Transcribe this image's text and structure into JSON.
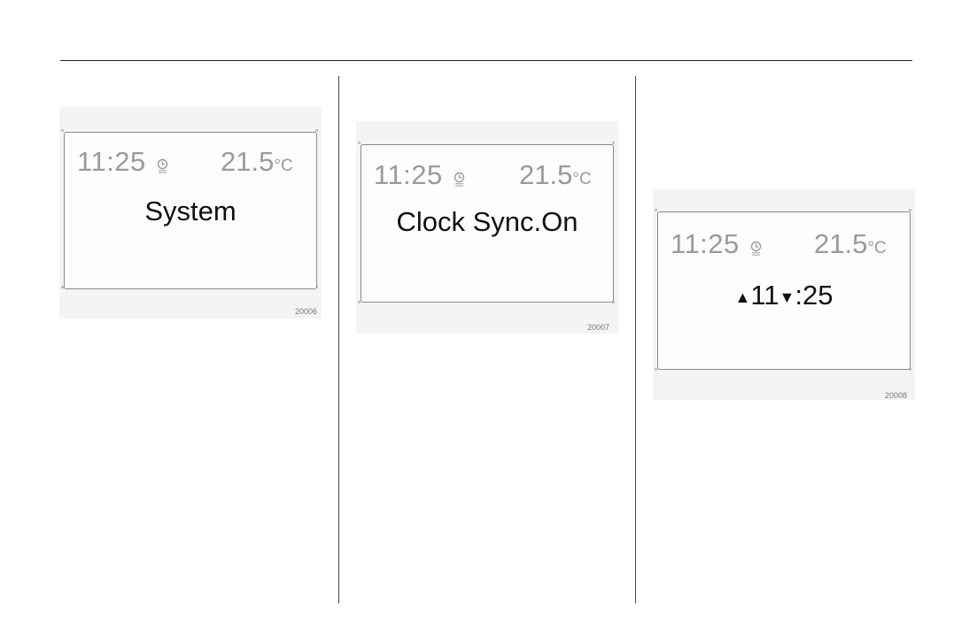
{
  "figures": [
    {
      "status_time": "11:25",
      "status_temp": "21.5",
      "status_unit": "°C",
      "message": "System",
      "code": "20006"
    },
    {
      "status_time": "11:25",
      "status_temp": "21.5",
      "status_unit": "°C",
      "message": "Clock Sync.On",
      "code": "20007"
    },
    {
      "status_time": "11:25",
      "status_temp": "21.5",
      "status_unit": "°C",
      "message_up_arrow": "▲",
      "message_hours": "11",
      "message_down_arrow": "▼",
      "message_minutes": ":25",
      "code": "20008"
    }
  ],
  "icons": {
    "clock_sync": "clock-sync-icon"
  }
}
